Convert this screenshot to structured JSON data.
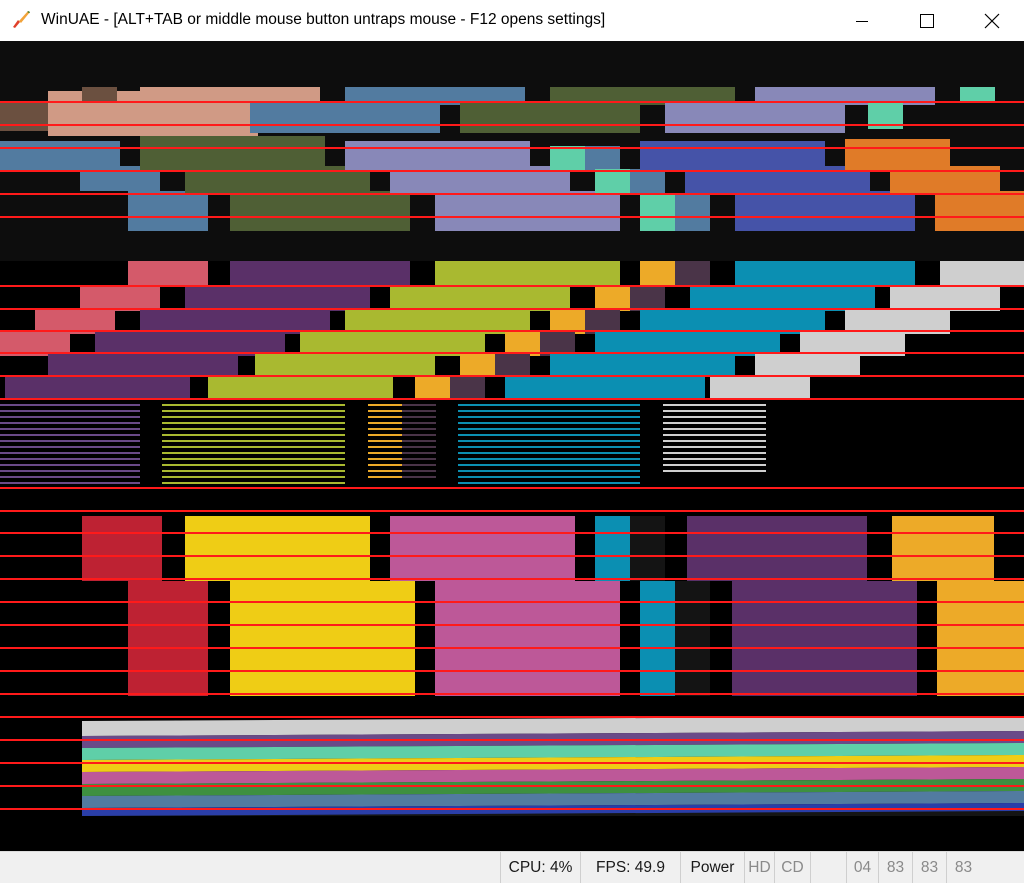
{
  "window": {
    "title": "WinUAE - [ALT+TAB or middle mouse button untraps mouse - F12 opens settings]",
    "icons": {
      "app": "winuae-brush-icon",
      "minimize": "minimize-icon",
      "maximize": "maximize-icon",
      "close": "close-icon"
    }
  },
  "emulator_display": {
    "content": "Amiga emulated screen showing a colorful graphics test pattern"
  },
  "statusbar": {
    "cpu": "CPU: 4%",
    "fps": "FPS: 49.9",
    "power": "Power",
    "hd": "HD",
    "cd": "CD",
    "tracks": [
      "04",
      "83",
      "83",
      "83"
    ]
  },
  "colors": {
    "titlebar_bg": "#ffffff",
    "display_bg": "#000000",
    "scanline_red": "#ff1a1a",
    "statusbar_bg": "#f0f0f0"
  }
}
